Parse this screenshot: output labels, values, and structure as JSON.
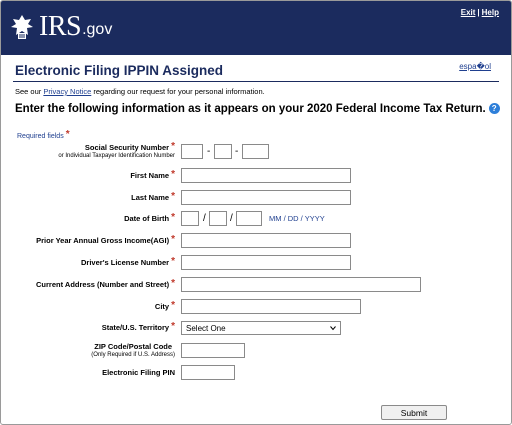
{
  "header": {
    "logo_text": "IRS",
    "logo_suffix": ".gov",
    "exit_label": "Exit",
    "separator": "|",
    "help_label": "Help",
    "background_color": "#1b2b5e"
  },
  "language_link": "espa�ol",
  "title": "Electronic Filing IPPIN Assigned",
  "notice": {
    "before": "See our ",
    "link": "Privacy Notice",
    "after": " regarding our request for your personal information."
  },
  "instruction": "Enter the following information as it appears on your 2020 Federal Income Tax Return.",
  "help_icon_text": "?",
  "required_note": "Required fields",
  "required_marker": "*",
  "fields": {
    "ssn": {
      "label": "Social Security Number",
      "sublabel": "or Individual Taxpayer Identification Number",
      "value": [
        "",
        "",
        ""
      ]
    },
    "first_name": {
      "label": "First Name",
      "value": ""
    },
    "last_name": {
      "label": "Last Name",
      "value": ""
    },
    "dob": {
      "label": "Date of Birth",
      "separator": "/",
      "hint": "MM / DD / YYYY"
    },
    "agi": {
      "label": "Prior Year Annual Gross Income(AGI)",
      "value": ""
    },
    "license": {
      "label": "Driver's License Number",
      "value": ""
    },
    "address": {
      "label": "Current Address (Number and Street)",
      "value": ""
    },
    "city": {
      "label": "City",
      "value": ""
    },
    "state": {
      "label": "State/U.S. Territory",
      "selected": "Select One"
    },
    "zip": {
      "label": "ZIP Code/Postal Code",
      "sublabel": "(Only Required if U.S. Address)",
      "value": ""
    },
    "pin": {
      "label": "Electronic Filing PIN",
      "value": ""
    }
  },
  "ssn_separator": "-",
  "submit_label": "Submit",
  "colors": {
    "link": "#1f3f8f",
    "required": "#c0392b",
    "help": "#2e7fd9"
  }
}
